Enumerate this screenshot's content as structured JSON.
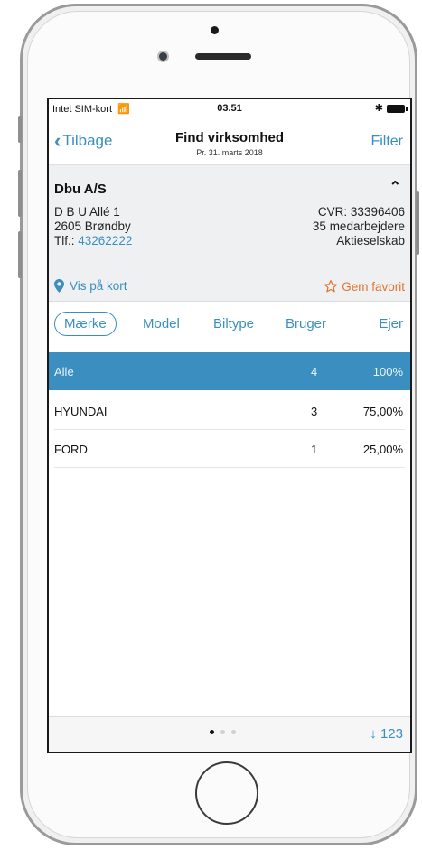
{
  "status_bar": {
    "carrier": "Intet SIM-kort",
    "time": "03.51"
  },
  "nav": {
    "back_label": "Tilbage",
    "title": "Find virksomhed",
    "subtitle": "Pr. 31. marts 2018",
    "filter_label": "Filter"
  },
  "company": {
    "name": "Dbu A/S",
    "address_line1": "D B U Allé 1",
    "address_line2": "2605 Brøndby",
    "phone_prefix": "Tlf.:",
    "phone": "43262222",
    "cvr": "CVR: 33396406",
    "employees": "35 medarbejdere",
    "type": "Aktieselskab",
    "map_label": "Vis på kort",
    "favorite_label": "Gem favorit"
  },
  "tabs": [
    {
      "label": "Mærke"
    },
    {
      "label": "Model"
    },
    {
      "label": "Biltype"
    },
    {
      "label": "Bruger"
    },
    {
      "label": "Ejer"
    }
  ],
  "rows": [
    {
      "label": "Alle",
      "count": "4",
      "pct": "100%"
    },
    {
      "label": "HYUNDAI",
      "count": "3",
      "pct": "75,00%"
    },
    {
      "label": "FORD",
      "count": "1",
      "pct": "25,00%"
    }
  ],
  "bottom": {
    "sort_label": "123",
    "page_count": 3,
    "current_page": 1
  },
  "colors": {
    "accent": "#3a8fc0",
    "favorite": "#e5732f",
    "selected_row": "#3a8fc0"
  },
  "icons": [
    "wifi-icon",
    "bluetooth-icon",
    "battery-icon",
    "chevron-left-icon",
    "chevron-up-icon",
    "map-pin-icon",
    "star-icon",
    "sort-arrow-icon"
  ]
}
